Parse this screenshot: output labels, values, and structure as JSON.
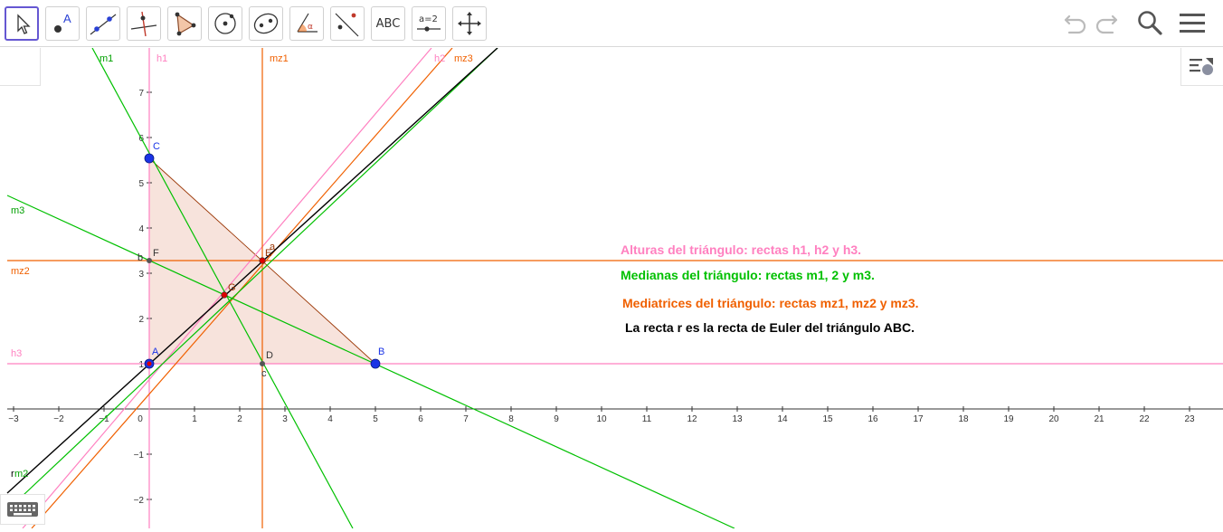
{
  "toolbar": {
    "tools": [
      {
        "name": "move-tool",
        "icon": "pointer-arrow-icon",
        "active": true
      },
      {
        "name": "point-tool",
        "icon": "point-A-icon",
        "label": "A"
      },
      {
        "name": "line-tool",
        "icon": "line-through-two-points-icon"
      },
      {
        "name": "perpendicular-line-tool",
        "icon": "perpendicular-line-icon"
      },
      {
        "name": "polygon-tool",
        "icon": "polygon-icon"
      },
      {
        "name": "circle-tool",
        "icon": "circle-center-point-icon"
      },
      {
        "name": "conic-tool",
        "icon": "conic-ellipse-icon"
      },
      {
        "name": "angle-tool",
        "icon": "angle-icon",
        "label": "α"
      },
      {
        "name": "reflect-tool",
        "icon": "reflect-about-line-icon"
      },
      {
        "name": "text-tool",
        "icon": "text-icon",
        "label": "ABC"
      },
      {
        "name": "slider-tool",
        "icon": "slider-icon",
        "label": "a=2"
      },
      {
        "name": "move-view-tool",
        "icon": "move-graphics-view-icon"
      }
    ],
    "right": [
      "undo-icon",
      "redo-icon",
      "search-icon",
      "menu-icon"
    ]
  },
  "graphics": {
    "axis": {
      "x_min": -3,
      "x_max": 23,
      "y_min": -2,
      "y_max": 7
    },
    "points": [
      {
        "name": "A",
        "x": 0,
        "y": 1
      },
      {
        "name": "B",
        "x": 5,
        "y": 1
      },
      {
        "name": "C",
        "x": 0,
        "y": 5.55
      },
      {
        "name": "D",
        "x": 2.5,
        "y": 1
      },
      {
        "name": "F",
        "x": 0,
        "y": 3.275
      },
      {
        "name": "E",
        "x": 2.5,
        "y": 3.275
      },
      {
        "name": "G",
        "x": 1.667,
        "y": 2.517
      }
    ],
    "line_labels": {
      "m1": "m1",
      "m2": "m2",
      "m3": "m3",
      "h1": "h1",
      "h2": "h2",
      "h3": "h3",
      "mz1": "mz1",
      "mz2": "mz2",
      "mz3": "mz3",
      "r": "r",
      "a": "a",
      "b": "b",
      "c": "c"
    },
    "point_labels": {
      "A": "A",
      "B": "B",
      "C": "C",
      "D": "D",
      "E": "E",
      "F": "F",
      "G": "G"
    },
    "notes": {
      "alturas": "Alturas del triángulo: rectas h1, h2 y h3.",
      "medianas": "Medianas del triángulo: rectas m1, 2 y m3.",
      "mediatrices": "Mediatrices del triángulo: rectas mz1, mz2 y mz3.",
      "euler": "La recta r es la recta de Euler del triángulo ABC."
    },
    "colors": {
      "altitude": "#ff80c0",
      "median": "#00c000",
      "perp_bisector": "#f06000",
      "euler": "#000000",
      "triangle_fill": "#f7e3dc",
      "triangle_edge": "#993300",
      "point_blue": "#1a33e6",
      "point_red": "#dd0000"
    }
  }
}
